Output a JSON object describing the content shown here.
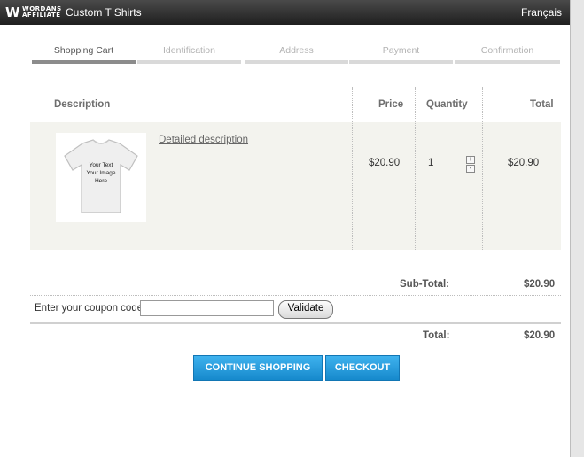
{
  "header": {
    "logo_mark": "W",
    "logo_line1": "WORDANS",
    "logo_line2": "AFFILIATE",
    "title": "Custom T Shirts",
    "language_link": "Français"
  },
  "steps": [
    {
      "label": "Shopping Cart",
      "active": true
    },
    {
      "label": "Identification",
      "active": false
    },
    {
      "label": "Address",
      "active": false
    },
    {
      "label": "Payment",
      "active": false
    },
    {
      "label": "Confirmation",
      "active": false
    }
  ],
  "table": {
    "headers": {
      "description": "Description",
      "price": "Price",
      "quantity": "Quantity",
      "total": "Total"
    },
    "items": [
      {
        "image_text": "Your Text Your Image Here",
        "detail_link": "Detailed description",
        "price": "$20.90",
        "quantity": "1",
        "total": "$20.90",
        "plus": "+",
        "minus": "-"
      }
    ]
  },
  "summary": {
    "subtotal_label": "Sub-Total:",
    "subtotal_value": "$20.90",
    "coupon_label": "Enter your coupon code",
    "coupon_value": "",
    "validate_label": "Validate",
    "total_label": "Total:",
    "total_value": "$20.90"
  },
  "actions": {
    "continue_label": "CONTINUE SHOPPING",
    "checkout_label": "CHECKOUT"
  },
  "colors": {
    "accent_blue": "#1e9ae0",
    "header_dark": "#2b2b2b",
    "row_bg": "#f3f3ee"
  }
}
